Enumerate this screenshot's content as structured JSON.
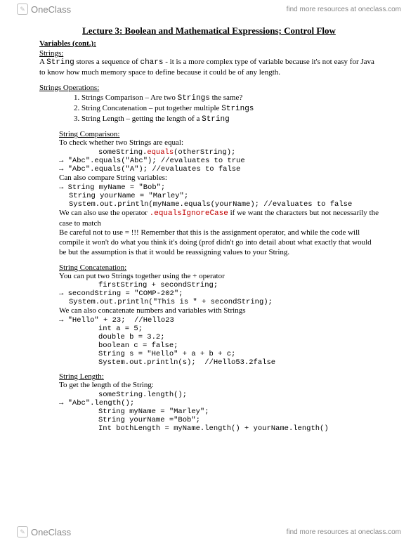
{
  "brand": {
    "logo_text": "OneClass",
    "logo_glyph": "✎",
    "tagline": "find more resources at oneclass.com"
  },
  "title": "Lecture 3: Boolean and Mathematical Expressions; Control Flow",
  "variables_heading": "Variables (cont.):",
  "strings_heading": "Strings:",
  "strings_intro_a": "A ",
  "strings_intro_code1": "String",
  "strings_intro_b": " stores a sequence of ",
  "strings_intro_code2": "chars",
  "strings_intro_c": " - it is a more complex type of variable because it's not easy for Java to know how much memory space to define because it could be of any length.",
  "ops_heading": "Strings Operations:",
  "ops": {
    "i1a": "Strings Comparison – Are two ",
    "i1b": "Strings",
    "i1c": " the same?",
    "i2a": "String Concatenation – put together multiple ",
    "i2b": "Strings",
    "i3a": "String Length – getting the length of a ",
    "i3b": "String"
  },
  "cmp": {
    "heading": "String Comparison:",
    "l1": "To check whether two Strings are equal:",
    "c1a": "someString.",
    "c1r": "equals",
    "c1b": "(otherString);",
    "c2": "\"Abc\".equals(\"Abc\"); //evaluates to true",
    "c3": "\"Abc\".equals(\"A\"); //evaluates to false",
    "l2": "Can also compare String variables:",
    "c4": "String myName = \"Bob\";",
    "c5": "String yourName = \"Marley\";",
    "c6": "System.out.println(myName.equals(yourName); //evaluates to false",
    "l3a": "We can also use the operator ",
    "l3r": ".equalsIgnoreCase",
    "l3b": " if we want the characters but not necessarily the case to match",
    "l4": "Be careful not to use = !!! Remember that this is the assignment operator, and while the code will compile it won't do what you think it's doing (prof didn't go into detail about what exactly that would be but the assumption is that it would be reassigning values to your String."
  },
  "cat": {
    "heading": "String Concatenation:",
    "l1": "You can put two Strings together using the + operator",
    "c1": "firstString + secondString;",
    "c2": "secondString = \"COMP-202\";",
    "c3": "System.out.println(\"This is \" + secondString);",
    "l2": "We can also concatenate numbers and variables with Strings",
    "c4": "\"Hello\" + 23;  //Hello23",
    "c5": "int a = 5;",
    "c6": "double b = 3.2;",
    "c7": "boolean c = false;",
    "c8": "String s = \"Hello\" + a + b + c;",
    "c9": "System.out.println(s);  //Hello53.2false"
  },
  "len": {
    "heading": "String Length:",
    "l1": "To get the length of the String:",
    "c1": "someString.length();",
    "c2": "\"Abc\".length();",
    "c3": "String myName = \"Marley\";",
    "c4": "String yourName =\"Bob\";",
    "c5": "Int bothLength = myName.length() + yourName.length()"
  }
}
